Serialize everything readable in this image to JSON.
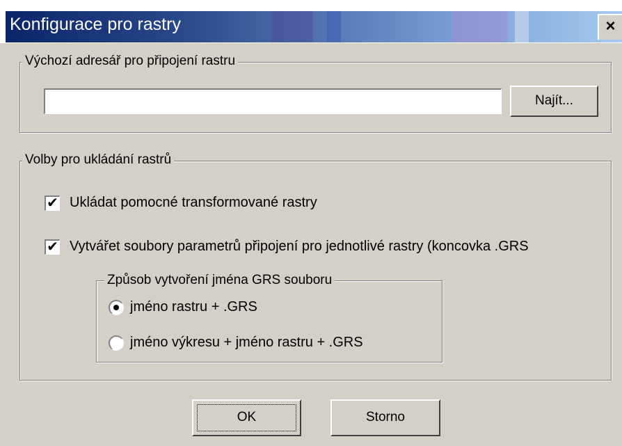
{
  "window": {
    "title": "Konfigurace pro rastry",
    "close_label": "×"
  },
  "directory_group": {
    "label": "Výchozí adresář pro připojení rastru",
    "path_value": "",
    "find_label": "Najít..."
  },
  "options_group": {
    "label": "Volby pro ukládání rastrů",
    "save_transformed": {
      "label": "Ukládat pomocné transformované rastry",
      "checked": true
    },
    "create_grs": {
      "label": "Vytvářet soubory parametrů připojení pro jednotlivé rastry (koncovka .GRS",
      "checked": true
    },
    "naming_group": {
      "label": "Způsob vytvoření jména GRS souboru",
      "options": [
        {
          "label": "jméno rastru + .GRS",
          "selected": true
        },
        {
          "label": "jméno výkresu + jméno rastru + .GRS",
          "selected": false
        }
      ]
    }
  },
  "buttons": {
    "ok": "OK",
    "cancel": "Storno"
  },
  "colors": {
    "face": "#d4d0c8",
    "title_start": "#0a246a",
    "title_end": "#a6caf0"
  }
}
